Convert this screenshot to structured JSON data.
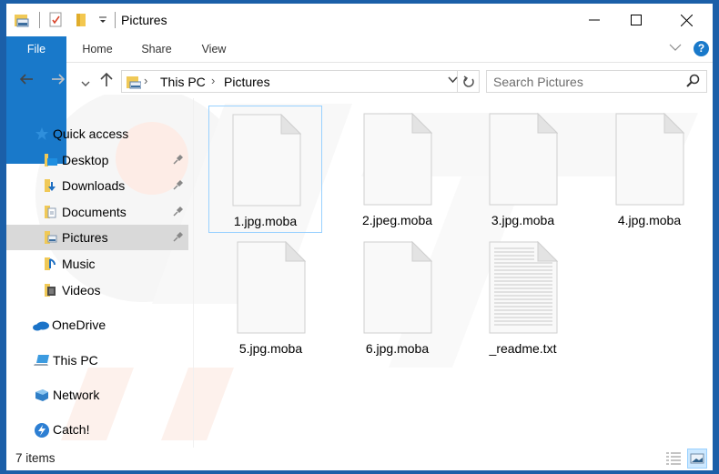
{
  "window": {
    "title": "Pictures",
    "controls": {
      "minimize": "–",
      "maximize": "☐",
      "close": "✕"
    }
  },
  "ribbon": {
    "tabs": [
      {
        "label": "File",
        "active": true
      },
      {
        "label": "Home"
      },
      {
        "label": "Share"
      },
      {
        "label": "View"
      }
    ],
    "help_label": "?"
  },
  "navigation": {
    "back": "←",
    "forward": "→",
    "recent": "⌄",
    "up": "↑",
    "breadcrumb": [
      "This PC",
      "Pictures"
    ],
    "refresh": "↻",
    "search_placeholder": "Search Pictures"
  },
  "sidebar": {
    "quick_access": {
      "label": "Quick access",
      "icon": "star-icon"
    },
    "pinned": [
      {
        "label": "Desktop",
        "icon": "desktop-folder-icon",
        "pinned": true
      },
      {
        "label": "Downloads",
        "icon": "downloads-folder-icon",
        "pinned": true
      },
      {
        "label": "Documents",
        "icon": "documents-folder-icon",
        "pinned": true
      },
      {
        "label": "Pictures",
        "icon": "pictures-folder-icon",
        "pinned": true,
        "selected": true
      },
      {
        "label": "Music",
        "icon": "music-folder-icon"
      },
      {
        "label": "Videos",
        "icon": "videos-folder-icon"
      }
    ],
    "locations": [
      {
        "label": "OneDrive",
        "icon": "onedrive-icon"
      },
      {
        "label": "This PC",
        "icon": "this-pc-icon"
      },
      {
        "label": "Network",
        "icon": "network-icon"
      },
      {
        "label": "Catch!",
        "icon": "catch-icon"
      }
    ]
  },
  "files": [
    {
      "name": "1.jpg.moba",
      "type": "blank",
      "selected": true
    },
    {
      "name": "2.jpeg.moba",
      "type": "blank"
    },
    {
      "name": "3.jpg.moba",
      "type": "blank"
    },
    {
      "name": "4.jpg.moba",
      "type": "blank"
    },
    {
      "name": "5.jpg.moba",
      "type": "blank"
    },
    {
      "name": "6.jpg.moba",
      "type": "blank"
    },
    {
      "name": "_readme.txt",
      "type": "text"
    }
  ],
  "status": {
    "item_count": "7 items",
    "view_modes": [
      "details",
      "large-icons"
    ],
    "active_view": "large-icons"
  },
  "colors": {
    "accent": "#1979ca",
    "frame": "#1b5fa8",
    "selection": "#d9d9d9",
    "item_selection_border": "#99d1ff"
  }
}
